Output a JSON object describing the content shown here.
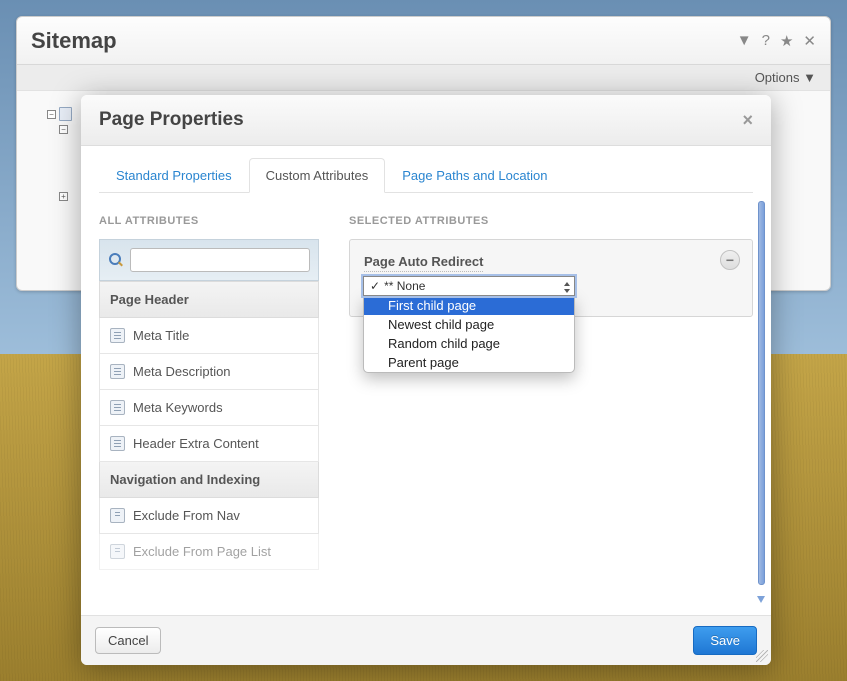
{
  "sitemap": {
    "title": "Sitemap",
    "options_label": "Options"
  },
  "modal": {
    "title": "Page Properties",
    "tabs": {
      "standard": "Standard Properties",
      "custom": "Custom Attributes",
      "paths": "Page Paths and Location"
    },
    "left": {
      "all_attr_label": "ALL ATTRIBUTES",
      "groups": {
        "page_header": "Page Header",
        "navigation": "Navigation and Indexing"
      },
      "items": {
        "meta_title": "Meta Title",
        "meta_desc": "Meta Description",
        "meta_keywords": "Meta Keywords",
        "header_extra": "Header Extra Content",
        "exclude_nav": "Exclude From Nav",
        "exclude_pagelist": "Exclude From Page List"
      }
    },
    "right": {
      "selected_label": "SELECTED ATTRIBUTES",
      "block_title": "Page Auto Redirect",
      "select": {
        "selected": "** None",
        "options": {
          "first_child": "First child page",
          "newest_child": "Newest child page",
          "random_child": "Random child page",
          "parent": "Parent page"
        }
      }
    },
    "buttons": {
      "cancel": "Cancel",
      "save": "Save"
    }
  }
}
